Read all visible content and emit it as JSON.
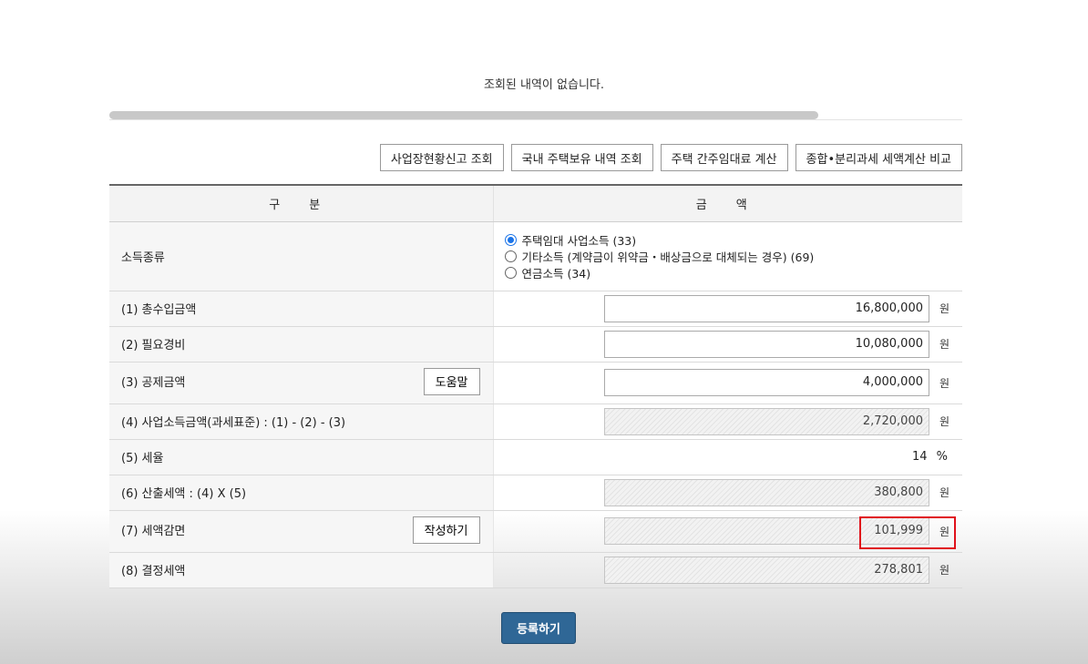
{
  "no_result_text": "조회된 내역이 없습니다.",
  "toolbar": {
    "buttons": [
      "사업장현황신고 조회",
      "국내 주택보유 내역 조회",
      "주택 간주임대료 계산",
      "종합•분리과세 세액계산 비교"
    ]
  },
  "table": {
    "header": {
      "col1": "구 분",
      "col2": "금 액"
    },
    "income_type": {
      "label": "소득종류",
      "options": [
        {
          "label": "주택임대 사업소득 (33)",
          "selected": true
        },
        {
          "label": "기타소득 (계약금이 위약금・배상금으로 대체되는 경우) (69)",
          "selected": false
        },
        {
          "label": "연금소득 (34)",
          "selected": false
        }
      ]
    },
    "rows": {
      "total_income": {
        "label": "(1) 총수입금액",
        "value": "16,800,000",
        "unit": "원"
      },
      "expenses": {
        "label": "(2) 필요경비",
        "value": "10,080,000",
        "unit": "원"
      },
      "deduction": {
        "label": "(3) 공제금액",
        "value": "4,000,000",
        "unit": "원",
        "button": "도움말"
      },
      "business_income": {
        "label": "(4) 사업소득금액(과세표준) : (1) - (2) - (3)",
        "value": "2,720,000",
        "unit": "원"
      },
      "tax_rate": {
        "label": "(5) 세율",
        "value": "14",
        "unit": "%"
      },
      "calculated_tax": {
        "label": "(6) 산출세액 : (4) X (5)",
        "value": "380,800",
        "unit": "원"
      },
      "tax_reduction": {
        "label": "(7) 세액감면",
        "value": "101,999",
        "unit": "원",
        "button": "작성하기"
      },
      "determined_tax": {
        "label": "(8) 결정세액",
        "value": "278,801",
        "unit": "원"
      }
    }
  },
  "submit_label": "등록하기",
  "colors": {
    "highlight": "#e0101a",
    "submit_bg": "#2f6796",
    "radio_accent": "#1a73e8"
  }
}
